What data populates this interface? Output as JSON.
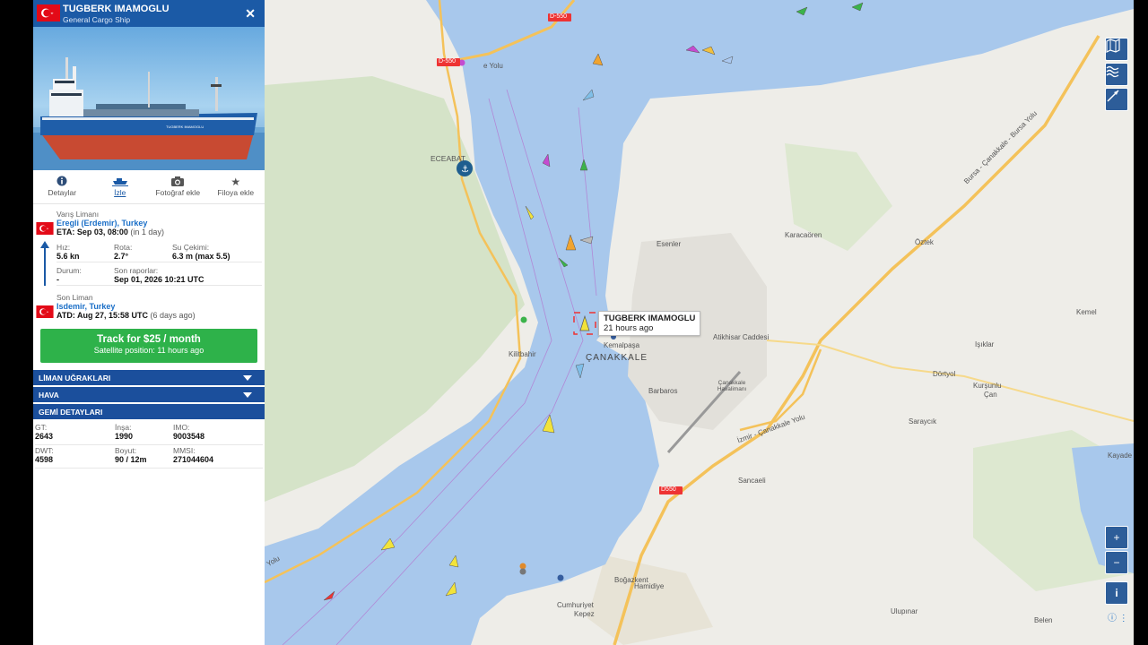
{
  "ship": {
    "name": "TUGBERK IMAMOGLU",
    "type": "General Cargo Ship",
    "flag": "turkey-flag-icon",
    "photo_ship_label": "TUGBERK IMAMOGLU"
  },
  "tabs": [
    {
      "label": "Detaylar",
      "icon": "info-icon"
    },
    {
      "label": "İzle",
      "icon": "ship-track-icon"
    },
    {
      "label": "Fotoğraf ekle",
      "icon": "camera-icon"
    },
    {
      "label": "Filoya ekle",
      "icon": "star-icon"
    }
  ],
  "destination": {
    "label": "Varış Limanı",
    "port": "Eregli (Erdemir), Turkey",
    "eta_prefix": "ETA:",
    "eta": "Sep 03, 08:00",
    "eta_note": "(in 1 day)"
  },
  "stats": {
    "speed_label": "Hız:",
    "speed": "5.6 kn",
    "course_label": "Rota:",
    "course": "2.7°",
    "draught_label": "Su Çekimi:",
    "draught": "6.3 m (max 5.5)",
    "status_label": "Durum:",
    "status": "-",
    "last_report_label": "Son raporlar:",
    "last_report": "Sep 01, 2026 10:21 UTC"
  },
  "last_port": {
    "label": "Son Liman",
    "port": "Isdemir, Turkey",
    "atd_prefix": "ATD:",
    "atd": "Aug 27, 15:58 UTC",
    "atd_note": "(6 days ago)"
  },
  "track_button": {
    "title": "Track for $25 / month",
    "subtitle": "Satellite position: 11 hours ago"
  },
  "sections": {
    "port_calls": "LİMAN UĞRAKLARI",
    "weather": "HAVA",
    "details": "GEMİ DETAYLARI"
  },
  "details": {
    "gt_label": "GT:",
    "gt": "2643",
    "built_label": "İnşa:",
    "built": "1990",
    "imo_label": "IMO:",
    "imo": "9003548",
    "dwt_label": "DWT:",
    "dwt": "4598",
    "size_label": "Boyut:",
    "size": "90 / 12m",
    "mmsi_label": "MMSI:",
    "mmsi": "271044604"
  },
  "map": {
    "tooltip_name": "TUGBERK IMAMOGLU",
    "tooltip_time": "21 hours ago",
    "labels": {
      "eceabat": "ECEABAT",
      "canakkale": "ÇANAKKALE",
      "kilitbahir": "Kilitbahir",
      "kemalpasa": "Kemalpaşa",
      "barbaros": "Barbaros",
      "esenler": "Esenler",
      "karacaoren": "Karacaören",
      "oztek": "Öztek",
      "kemel": "Kemel",
      "iplikler": "Işıklar",
      "dortyol": "Dörtyol",
      "kursunlu": "Kurşunlu",
      "can": "Çan",
      "saraycik": "Saraycık",
      "kayadere": "Kayade",
      "sancaeli": "Sancaeli",
      "bogazkent": "Boğazkent",
      "hamidiye": "Hamidiye",
      "cumhuriyet": "Cumhuriyet",
      "kepez": "Kepez",
      "ulupinar": "Ulupınar",
      "belen": "Belen",
      "airport": "Çanakkale Havalimanı",
      "atikhisar": "Atikhisar Caddesi",
      "izmir_road": "İzmir - Çanakkale Yolu",
      "bursa_road": "Bursa - Çanakkale - Bursa Yolu",
      "d550_a": "D-550",
      "d550_b": "D-550",
      "d550_c": "D550",
      "yolu": "e Yolu",
      "yolu2": "Yolu"
    },
    "controls": {
      "zoom_in": "+",
      "zoom_out": "−",
      "info": "i"
    }
  },
  "colors": {
    "header_blue": "#1b5aa6",
    "section_blue": "#1b4f9c",
    "track_green": "#2eb24a",
    "water": "#a8c8ec",
    "land": "#eeede8"
  }
}
